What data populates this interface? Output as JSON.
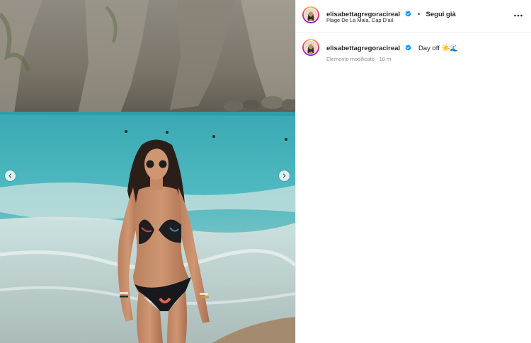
{
  "post": {
    "username": "elisabettagregoracireal",
    "follow_label": "Segui già",
    "separator": "•",
    "location": "Plage De La Mala, Cap D'ail.",
    "caption": "Day off ☀️🌊",
    "edited_label": "Elemento modificato",
    "meta_separator": "·",
    "time_ago": "18 m"
  },
  "icons": {
    "verified": "verified-badge-icon",
    "more": "more-options-icon",
    "prev": "chevron-left-icon",
    "next": "chevron-right-icon"
  },
  "colors": {
    "verified": "#0095f6",
    "text": "#262626",
    "secondary": "#8e8e8e",
    "divider": "#efefef"
  }
}
